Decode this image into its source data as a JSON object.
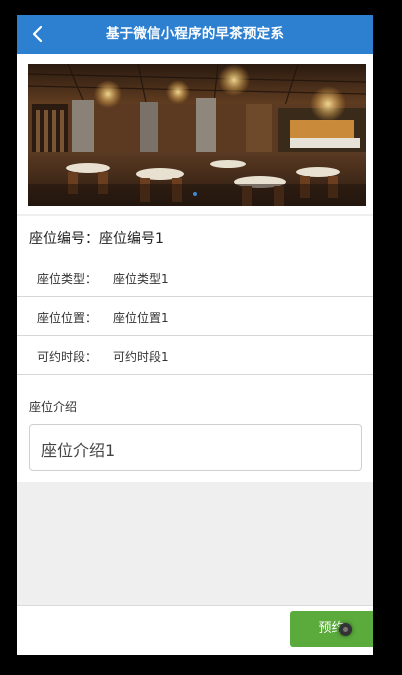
{
  "navbar": {
    "title": "基于微信小程序的早茶预定系"
  },
  "seat": {
    "seat_no": "座位编号：座位编号1",
    "rows": [
      {
        "label": "座位类型：",
        "value": "座位类型1"
      },
      {
        "label": "座位位置：",
        "value": "座位位置1"
      },
      {
        "label": "可约时段：",
        "value": "可约时段1"
      }
    ],
    "intro_label": "座位介绍",
    "intro_text": "座位介绍1"
  },
  "footer": {
    "book_label": "预约"
  },
  "colors": {
    "navbar_bg": "#2d7fd0",
    "book_button": "#5aab3c",
    "page_bg": "#efefef"
  }
}
